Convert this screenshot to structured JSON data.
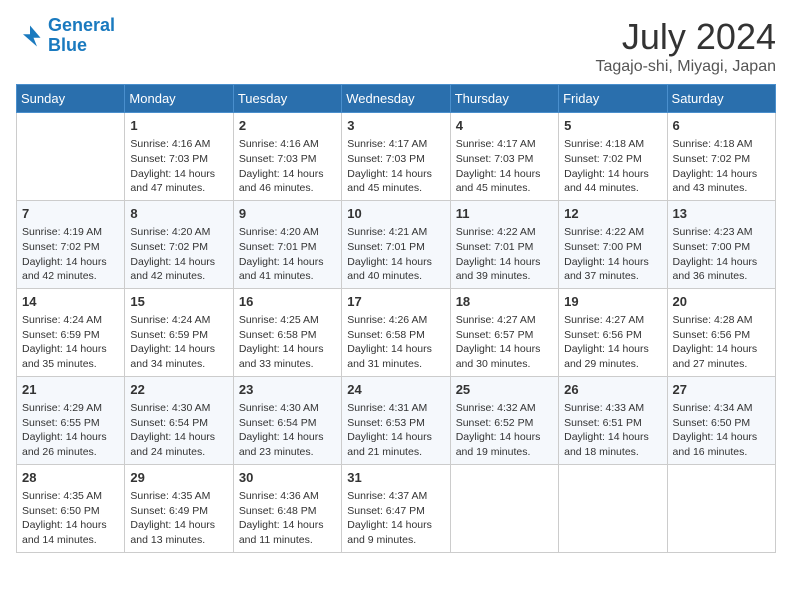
{
  "logo": {
    "line1": "General",
    "line2": "Blue"
  },
  "title": "July 2024",
  "subtitle": "Tagajo-shi, Miyagi, Japan",
  "weekdays": [
    "Sunday",
    "Monday",
    "Tuesday",
    "Wednesday",
    "Thursday",
    "Friday",
    "Saturday"
  ],
  "weeks": [
    [
      {
        "day": "",
        "info": ""
      },
      {
        "day": "1",
        "info": "Sunrise: 4:16 AM\nSunset: 7:03 PM\nDaylight: 14 hours\nand 47 minutes."
      },
      {
        "day": "2",
        "info": "Sunrise: 4:16 AM\nSunset: 7:03 PM\nDaylight: 14 hours\nand 46 minutes."
      },
      {
        "day": "3",
        "info": "Sunrise: 4:17 AM\nSunset: 7:03 PM\nDaylight: 14 hours\nand 45 minutes."
      },
      {
        "day": "4",
        "info": "Sunrise: 4:17 AM\nSunset: 7:03 PM\nDaylight: 14 hours\nand 45 minutes."
      },
      {
        "day": "5",
        "info": "Sunrise: 4:18 AM\nSunset: 7:02 PM\nDaylight: 14 hours\nand 44 minutes."
      },
      {
        "day": "6",
        "info": "Sunrise: 4:18 AM\nSunset: 7:02 PM\nDaylight: 14 hours\nand 43 minutes."
      }
    ],
    [
      {
        "day": "7",
        "info": "Sunrise: 4:19 AM\nSunset: 7:02 PM\nDaylight: 14 hours\nand 42 minutes."
      },
      {
        "day": "8",
        "info": "Sunrise: 4:20 AM\nSunset: 7:02 PM\nDaylight: 14 hours\nand 42 minutes."
      },
      {
        "day": "9",
        "info": "Sunrise: 4:20 AM\nSunset: 7:01 PM\nDaylight: 14 hours\nand 41 minutes."
      },
      {
        "day": "10",
        "info": "Sunrise: 4:21 AM\nSunset: 7:01 PM\nDaylight: 14 hours\nand 40 minutes."
      },
      {
        "day": "11",
        "info": "Sunrise: 4:22 AM\nSunset: 7:01 PM\nDaylight: 14 hours\nand 39 minutes."
      },
      {
        "day": "12",
        "info": "Sunrise: 4:22 AM\nSunset: 7:00 PM\nDaylight: 14 hours\nand 37 minutes."
      },
      {
        "day": "13",
        "info": "Sunrise: 4:23 AM\nSunset: 7:00 PM\nDaylight: 14 hours\nand 36 minutes."
      }
    ],
    [
      {
        "day": "14",
        "info": "Sunrise: 4:24 AM\nSunset: 6:59 PM\nDaylight: 14 hours\nand 35 minutes."
      },
      {
        "day": "15",
        "info": "Sunrise: 4:24 AM\nSunset: 6:59 PM\nDaylight: 14 hours\nand 34 minutes."
      },
      {
        "day": "16",
        "info": "Sunrise: 4:25 AM\nSunset: 6:58 PM\nDaylight: 14 hours\nand 33 minutes."
      },
      {
        "day": "17",
        "info": "Sunrise: 4:26 AM\nSunset: 6:58 PM\nDaylight: 14 hours\nand 31 minutes."
      },
      {
        "day": "18",
        "info": "Sunrise: 4:27 AM\nSunset: 6:57 PM\nDaylight: 14 hours\nand 30 minutes."
      },
      {
        "day": "19",
        "info": "Sunrise: 4:27 AM\nSunset: 6:56 PM\nDaylight: 14 hours\nand 29 minutes."
      },
      {
        "day": "20",
        "info": "Sunrise: 4:28 AM\nSunset: 6:56 PM\nDaylight: 14 hours\nand 27 minutes."
      }
    ],
    [
      {
        "day": "21",
        "info": "Sunrise: 4:29 AM\nSunset: 6:55 PM\nDaylight: 14 hours\nand 26 minutes."
      },
      {
        "day": "22",
        "info": "Sunrise: 4:30 AM\nSunset: 6:54 PM\nDaylight: 14 hours\nand 24 minutes."
      },
      {
        "day": "23",
        "info": "Sunrise: 4:30 AM\nSunset: 6:54 PM\nDaylight: 14 hours\nand 23 minutes."
      },
      {
        "day": "24",
        "info": "Sunrise: 4:31 AM\nSunset: 6:53 PM\nDaylight: 14 hours\nand 21 minutes."
      },
      {
        "day": "25",
        "info": "Sunrise: 4:32 AM\nSunset: 6:52 PM\nDaylight: 14 hours\nand 19 minutes."
      },
      {
        "day": "26",
        "info": "Sunrise: 4:33 AM\nSunset: 6:51 PM\nDaylight: 14 hours\nand 18 minutes."
      },
      {
        "day": "27",
        "info": "Sunrise: 4:34 AM\nSunset: 6:50 PM\nDaylight: 14 hours\nand 16 minutes."
      }
    ],
    [
      {
        "day": "28",
        "info": "Sunrise: 4:35 AM\nSunset: 6:50 PM\nDaylight: 14 hours\nand 14 minutes."
      },
      {
        "day": "29",
        "info": "Sunrise: 4:35 AM\nSunset: 6:49 PM\nDaylight: 14 hours\nand 13 minutes."
      },
      {
        "day": "30",
        "info": "Sunrise: 4:36 AM\nSunset: 6:48 PM\nDaylight: 14 hours\nand 11 minutes."
      },
      {
        "day": "31",
        "info": "Sunrise: 4:37 AM\nSunset: 6:47 PM\nDaylight: 14 hours\nand 9 minutes."
      },
      {
        "day": "",
        "info": ""
      },
      {
        "day": "",
        "info": ""
      },
      {
        "day": "",
        "info": ""
      }
    ]
  ]
}
